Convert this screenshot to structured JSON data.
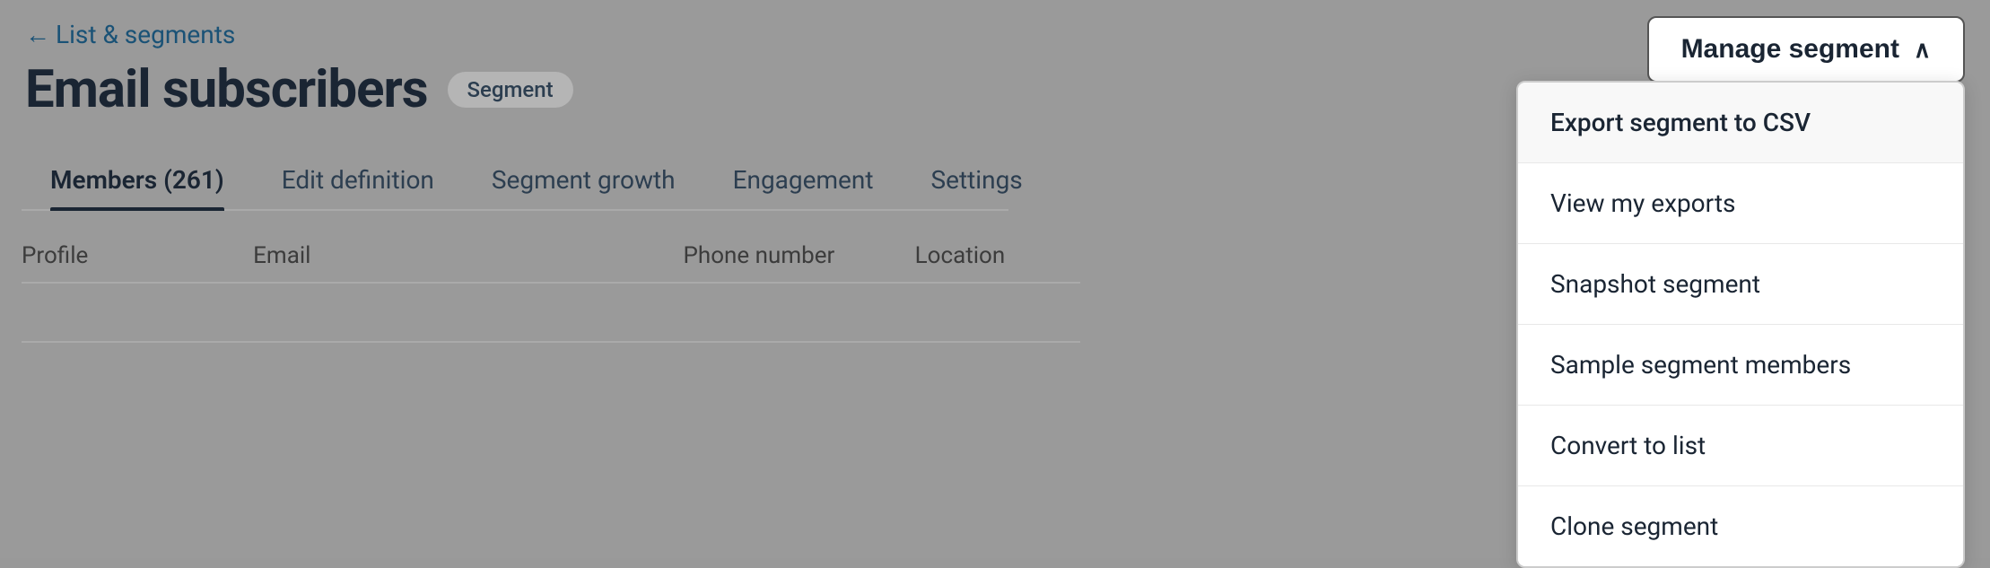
{
  "back_link": {
    "label": "List & segments",
    "arrow": "←"
  },
  "page": {
    "title": "Email subscribers",
    "badge": "Segment"
  },
  "tabs": [
    {
      "label": "Members (261)",
      "active": true
    },
    {
      "label": "Edit definition",
      "active": false
    },
    {
      "label": "Segment growth",
      "active": false
    },
    {
      "label": "Engagement",
      "active": false
    },
    {
      "label": "Settings",
      "active": false
    }
  ],
  "table": {
    "columns": [
      "Profile",
      "Email",
      "Phone number",
      "Location"
    ]
  },
  "manage_button": {
    "label": "Manage segment",
    "chevron": "∧"
  },
  "dropdown": {
    "items": [
      "Export segment to CSV",
      "View my exports",
      "Snapshot segment",
      "Sample segment members",
      "Convert to list",
      "Clone segment"
    ]
  }
}
